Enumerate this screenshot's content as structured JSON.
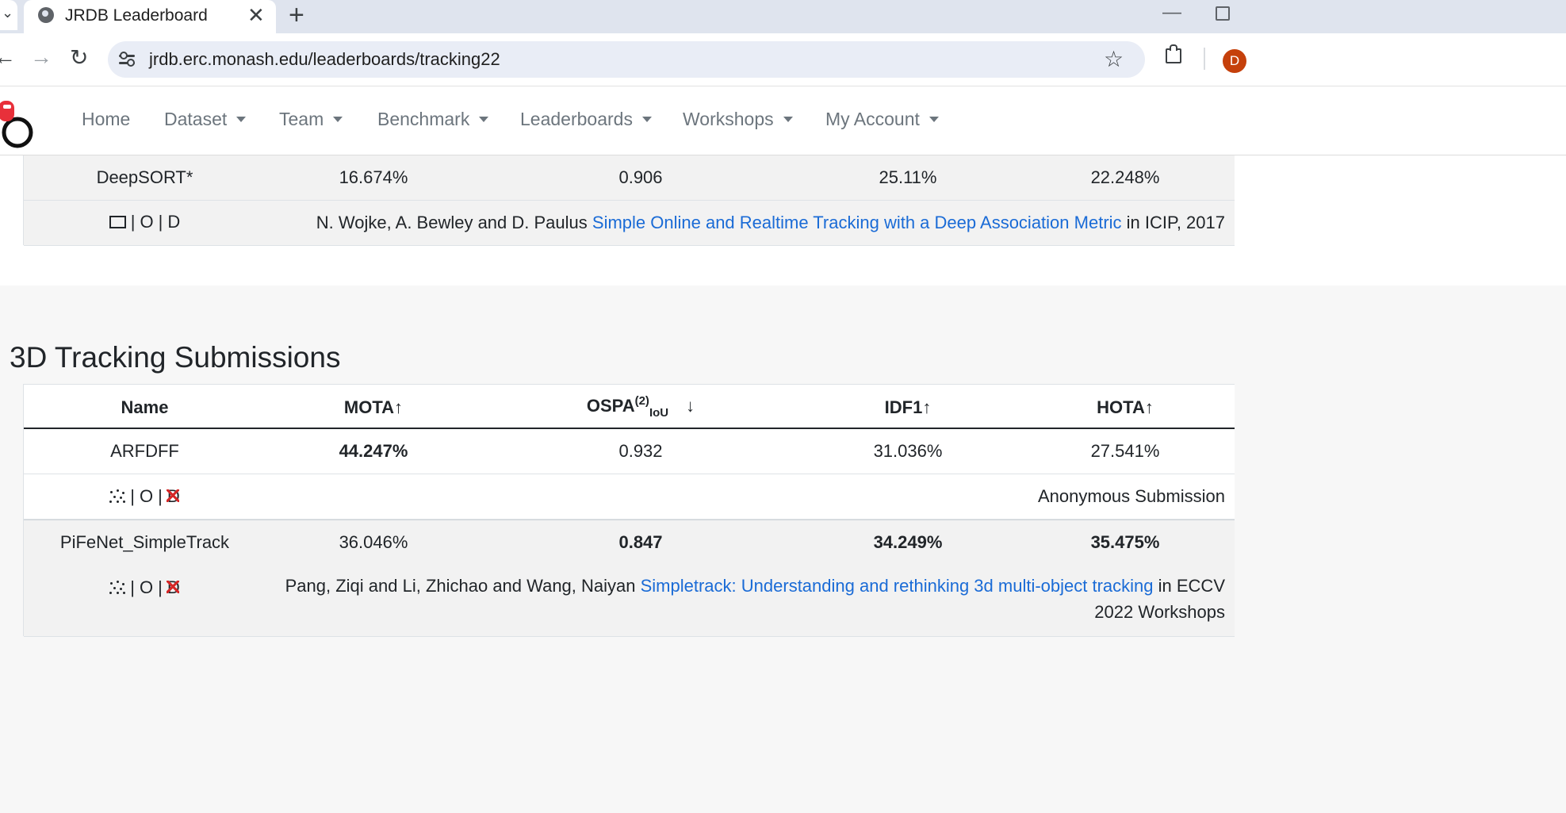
{
  "browser": {
    "tab_title": "JRDB Leaderboard",
    "tab_close": "✕",
    "new_tab": "+",
    "url": "jrdb.erc.monash.edu/leaderboards/tracking22",
    "profile_initial": "D",
    "minimize": "—"
  },
  "nav": {
    "home": "Home",
    "dataset": "Dataset",
    "team": "Team",
    "benchmark": "Benchmark",
    "leaderboards": "Leaderboards",
    "workshops": "Workshops",
    "my_account": "My Account"
  },
  "table_2d": {
    "rows": [
      {
        "name": "DeepSORT*",
        "mota": "16.674%",
        "ospa": "0.906",
        "idf1": "25.11%",
        "hota": "22.248%",
        "ref_prefix": "N. Wojke, A. Bewley and D. Paulus ",
        "ref_link": "Simple Online and Realtime Tracking with a Deep Association Metric",
        "ref_suffix": " in ICIP, 2017",
        "icon_o": "O",
        "icon_d": "D"
      }
    ]
  },
  "section_3d": {
    "title": "3D Tracking Submissions",
    "headers": {
      "name": "Name",
      "mota": "MOTA↑",
      "ospa_main": "OSPA",
      "ospa_sup": "(2)",
      "ospa_sub": "IoU",
      "ospa_arrow": "↓",
      "idf1": "IDF1↑",
      "hota": "HOTA↑"
    },
    "rows": [
      {
        "name": "ARFDFF",
        "mota": "44.247%",
        "ospa": "0.932",
        "idf1": "31.036%",
        "hota": "27.541%",
        "ref_text": "Anonymous Submission",
        "icon_o": "O",
        "icon_d": "D"
      },
      {
        "name": "PiFeNet_SimpleTrack",
        "mota": "36.046%",
        "ospa": "0.847",
        "idf1": "34.249%",
        "hota": "35.475%",
        "ref_prefix": "Pang, Ziqi and Li, Zhichao and Wang, Naiyan ",
        "ref_link": "Simpletrack: Understanding and rethinking 3d multi-object tracking",
        "ref_suffix": " in ECCV",
        "ref_line2": "2022 Workshops",
        "icon_o": "O",
        "icon_d": "D"
      }
    ]
  },
  "colors": {
    "link": "#1a6bd6",
    "no_depth_cross": "#d62828",
    "logo_red": "#e8303a"
  }
}
